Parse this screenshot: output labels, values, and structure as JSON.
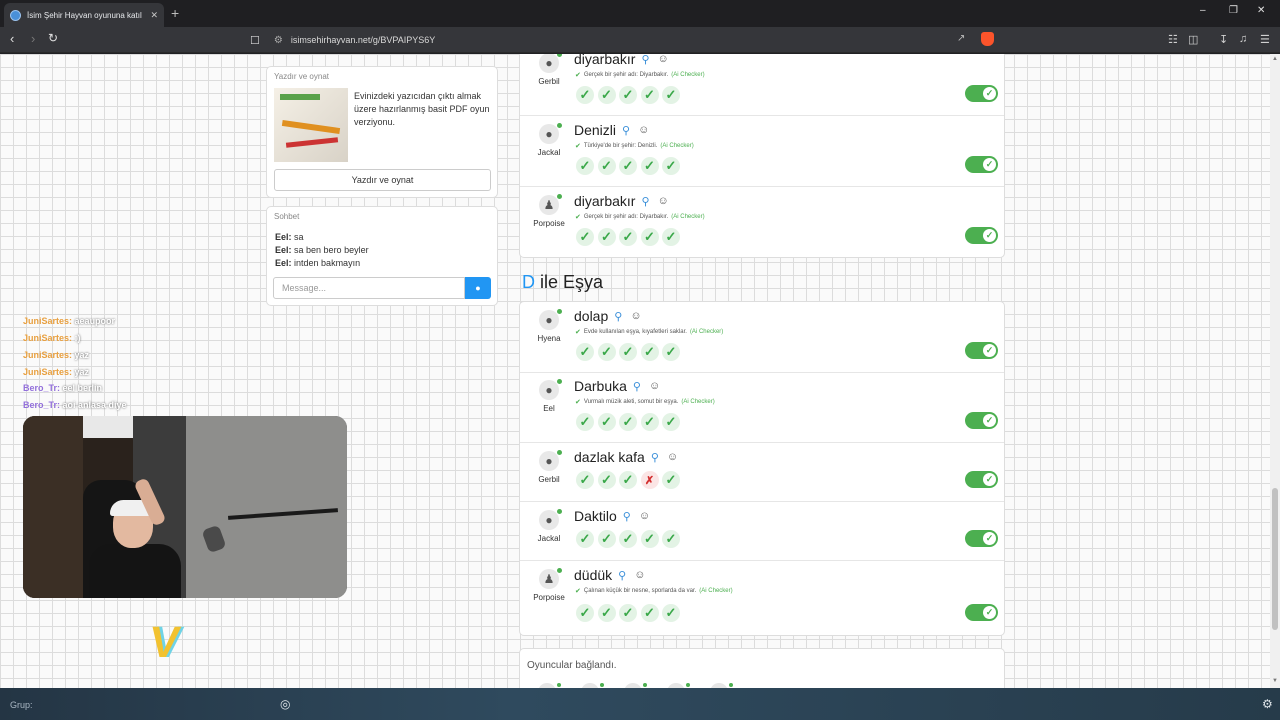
{
  "browser": {
    "tab_title": "İsim Şehir Hayvan oyununa katıl",
    "tab_close": "✕",
    "new_tab": "+",
    "url": "isimsehirhayvan.net/g/BVPAIPYS6Y",
    "window_controls": {
      "minimize": "–",
      "maximize": "❐",
      "close": "✕"
    }
  },
  "sidebar": {
    "print_card": {
      "title": "Yazdır ve oynat",
      "description": "Evinizdeki yazıcıdan çıktı almak üzere hazırlanmış basit PDF oyun verziyonu.",
      "button": "Yazdır ve oynat"
    },
    "chat": {
      "title": "Sohbet",
      "messages": [
        {
          "user": "Eel:",
          "text": "sa"
        },
        {
          "user": "Eel:",
          "text": "sa ben bero beyler"
        },
        {
          "user": "Eel:",
          "text": "intden bakmayın"
        }
      ],
      "placeholder": "Message...",
      "send_icon": "chat-bubble-icon"
    }
  },
  "stream_overlay": {
    "chat": [
      {
        "user": "JuniSartes:",
        "text": "aeaupoor"
      },
      {
        "user": "JuniSartes:",
        "text": ":)"
      },
      {
        "user": "JuniSartes:",
        "text": "yaz"
      },
      {
        "user": "JuniSartes:",
        "text": "yaz"
      },
      {
        "user": "Bero_Tr:",
        "text": "eel berlin"
      },
      {
        "user": "Bero_Tr:",
        "text": "aoi anlasa diye"
      }
    ],
    "logo": "V"
  },
  "game": {
    "city_rows": [
      {
        "player": "Gerbil",
        "answer": "diyarbakır",
        "verdict": "Gerçek bir şehir adı: Diyarbakır.",
        "checker": "(Ai Checker)",
        "votes": [
          "yes",
          "yes",
          "yes",
          "yes",
          "yes"
        ],
        "accepted": true
      },
      {
        "player": "Jackal",
        "answer": "Denizli",
        "verdict": "Türkiye'de bir şehir: Denizli.",
        "checker": "(Ai Checker)",
        "votes": [
          "yes",
          "yes",
          "yes",
          "yes",
          "yes"
        ],
        "accepted": true
      },
      {
        "player": "Porpoise",
        "answer": "diyarbakır",
        "verdict": "Gerçek bir şehir adı: Diyarbakır.",
        "checker": "(Ai Checker)",
        "votes": [
          "yes",
          "yes",
          "yes",
          "yes",
          "yes"
        ],
        "accepted": true
      }
    ],
    "category": {
      "letter": "D",
      "title": "ile Eşya"
    },
    "item_rows": [
      {
        "player": "Hyena",
        "answer": "dolap",
        "verdict": "Evde kullanılan eşya, kıyafetleri saklar.",
        "checker": "(Ai Checker)",
        "votes": [
          "yes",
          "yes",
          "yes",
          "yes",
          "yes"
        ],
        "accepted": true
      },
      {
        "player": "Eel",
        "answer": "Darbuka",
        "verdict": "Vurmalı müzik aleti, somut bir eşya.",
        "checker": "(Ai Checker)",
        "votes": [
          "yes",
          "yes",
          "yes",
          "yes",
          "yes"
        ],
        "accepted": true
      },
      {
        "player": "Gerbil",
        "answer": "dazlak kafa",
        "verdict": "",
        "checker": "",
        "votes": [
          "yes",
          "yes",
          "yes",
          "no",
          "yes"
        ],
        "accepted": true
      },
      {
        "player": "Jackal",
        "answer": "Daktilo",
        "verdict": "",
        "checker": "",
        "votes": [
          "yes",
          "yes",
          "yes",
          "yes",
          "yes"
        ],
        "accepted": true
      },
      {
        "player": "Porpoise",
        "answer": "düdük",
        "verdict": "Çalınan küçük bir nesne, sporlarda da var.",
        "checker": "(Ai Checker)",
        "votes": [
          "yes",
          "yes",
          "yes",
          "yes",
          "yes"
        ],
        "accepted": true
      }
    ],
    "status": "Oyuncular bağlandı."
  },
  "taskbar": {
    "label": "Grup:"
  },
  "colors": {
    "accent": "#2196f3",
    "success": "#4caf50",
    "error": "#d32f2f"
  }
}
